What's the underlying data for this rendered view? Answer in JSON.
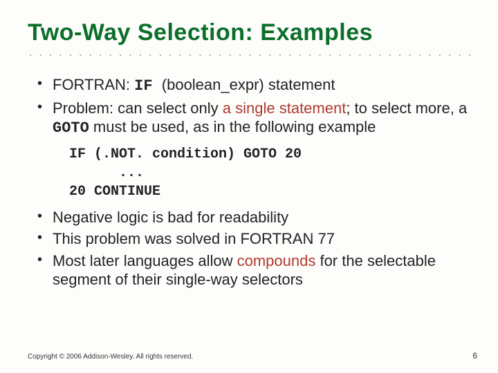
{
  "title": "Two-Way Selection: Examples",
  "bullets": {
    "b1_pre": "FORTRAN: ",
    "b1_code": "IF ",
    "b1_post": "(boolean_expr) statement",
    "b2_pre": "Problem: can select only ",
    "b2_hl": "a single statement",
    "b2_mid": "; to select more, a ",
    "b2_code": "GOTO",
    "b2_post": " must be used, as in the following example",
    "b3": "Negative logic is bad for readability",
    "b4": "This problem was solved in FORTRAN 77",
    "b5_pre": "Most later languages allow ",
    "b5_hl": "compounds",
    "b5_post": " for the selectable segment of their single-way selectors"
  },
  "code": {
    "l1": "IF (.NOT. condition) GOTO 20",
    "l2": "      ...",
    "l3": "20 CONTINUE"
  },
  "footer": "Copyright © 2006 Addison-Wesley. All rights reserved.",
  "page": "6",
  "dots": "..........................................................................."
}
